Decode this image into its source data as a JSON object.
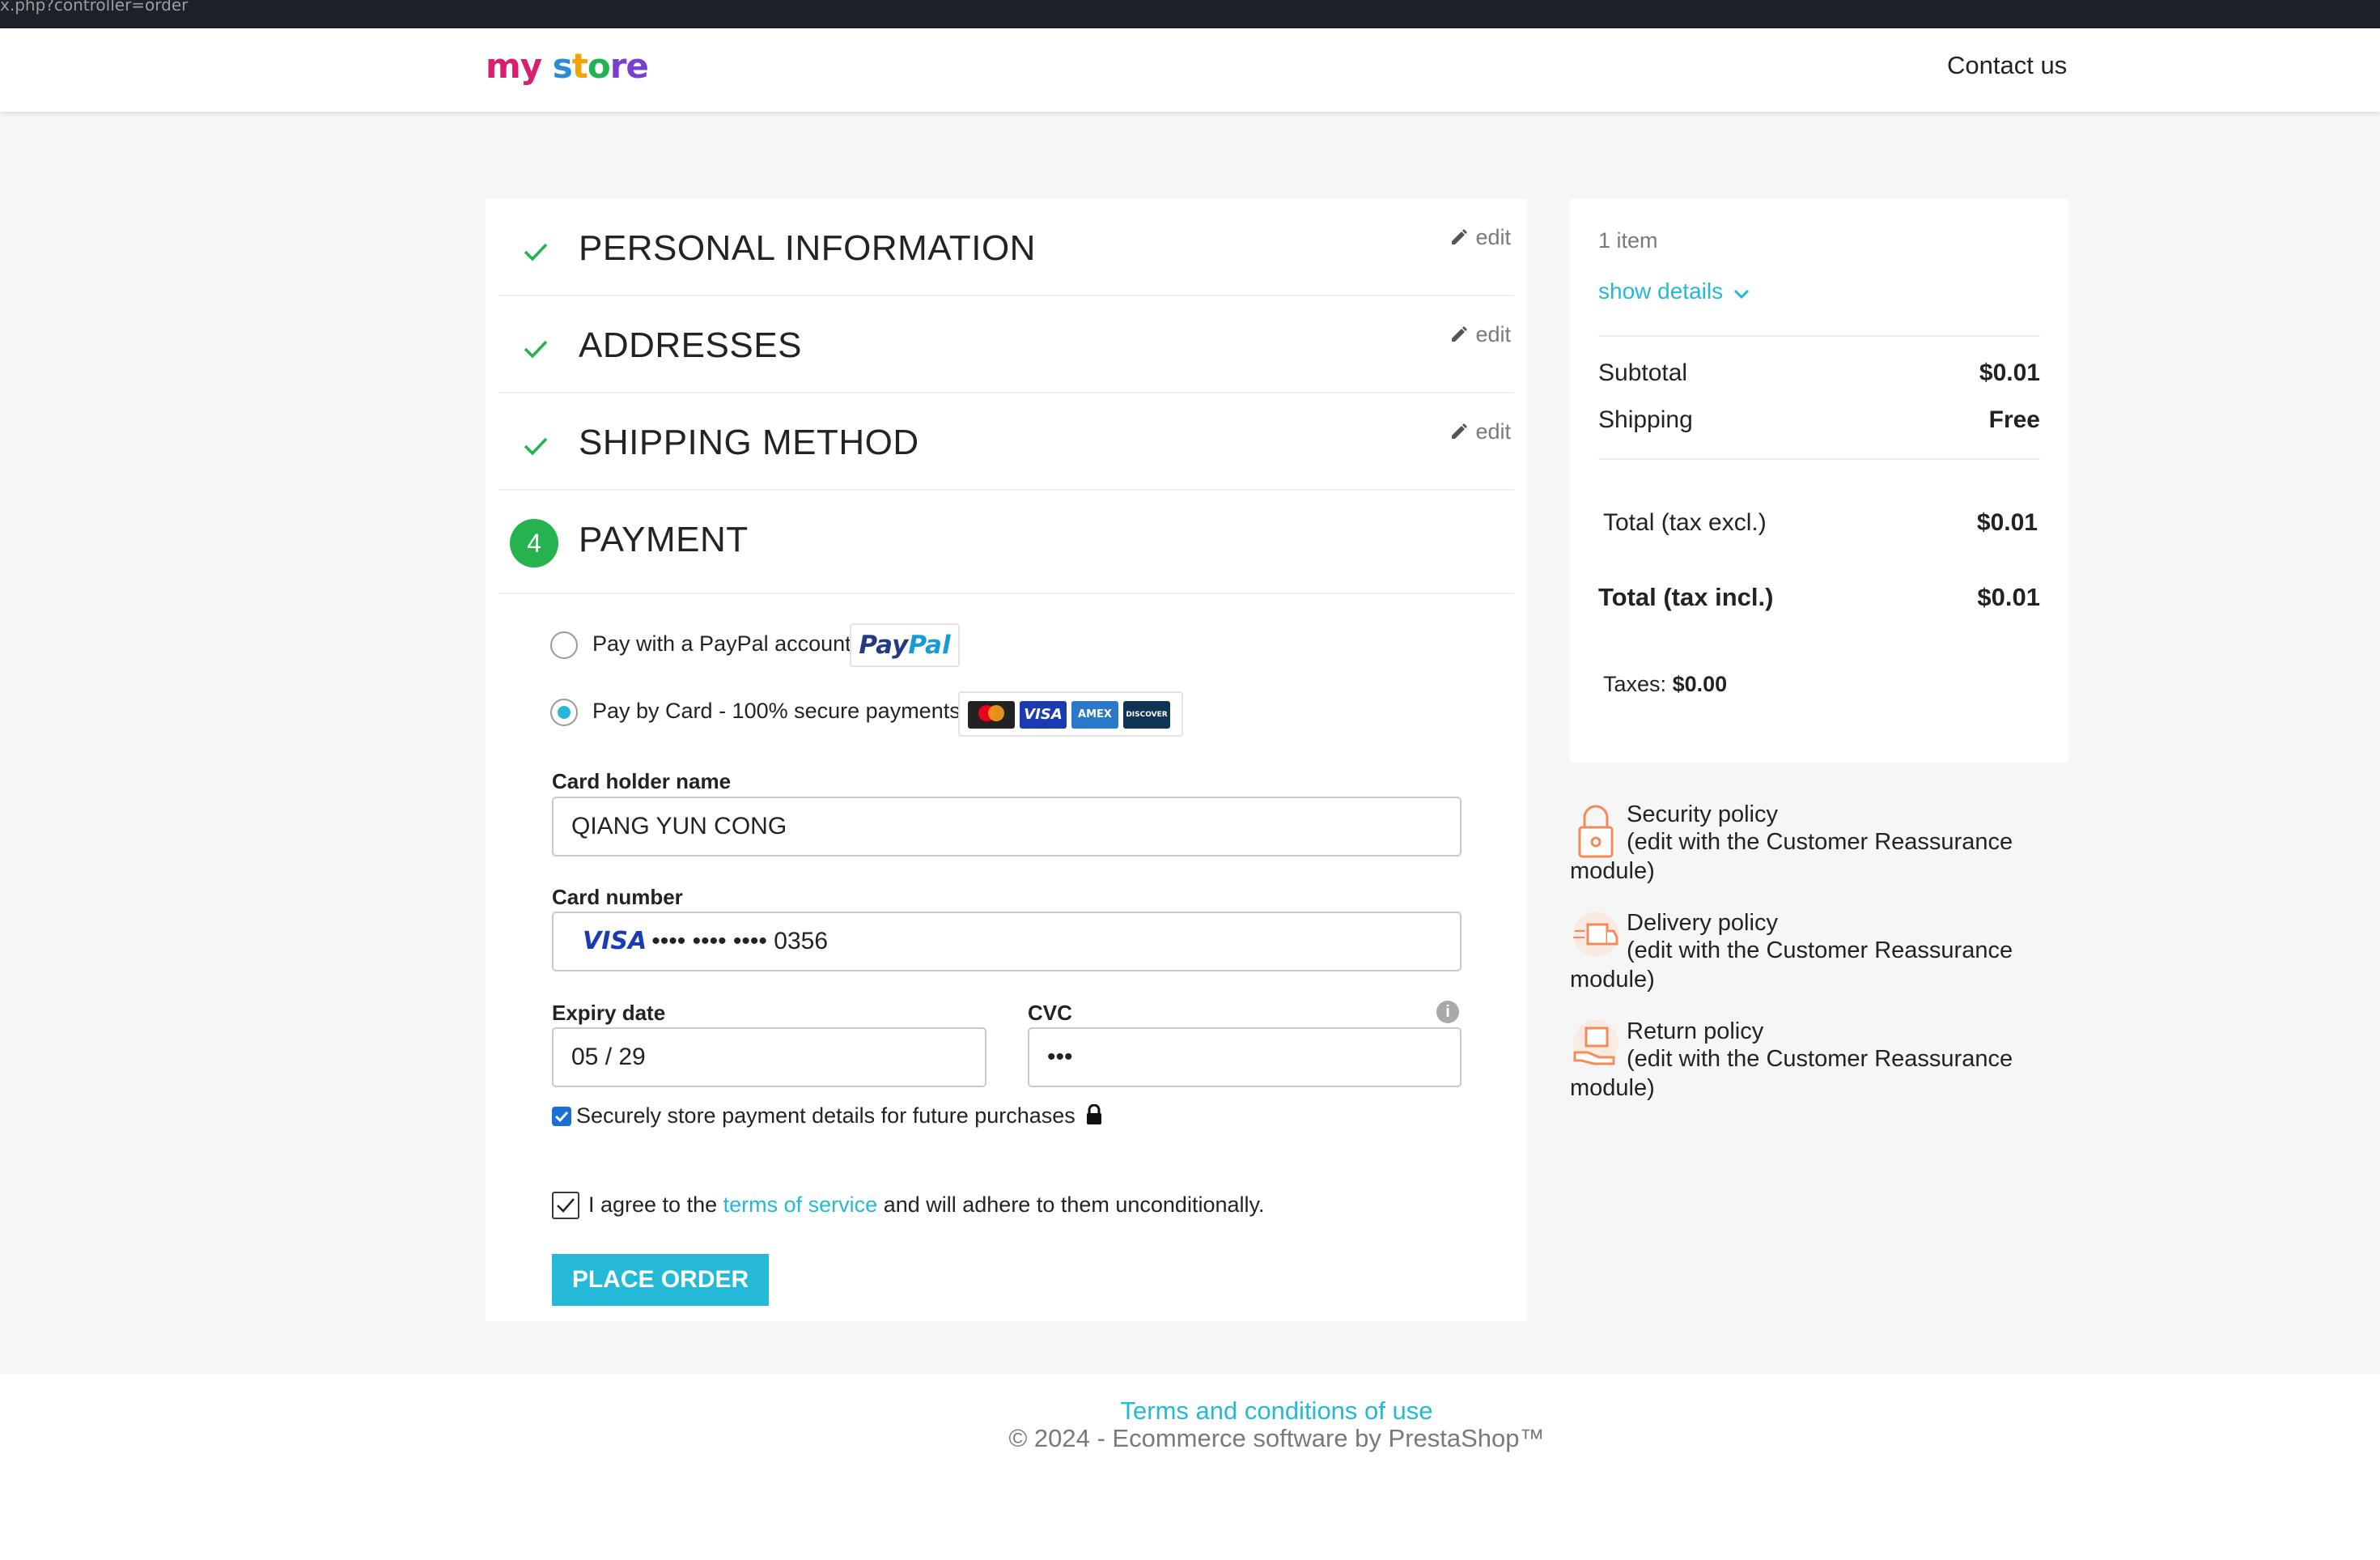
{
  "browser": {
    "url_fragment": "x.php?controller=order"
  },
  "header": {
    "logo": {
      "part1": "my",
      "part2": "s",
      "part3": "t",
      "part4": "o",
      "part5": "re"
    },
    "contact_label": "Contact us"
  },
  "steps": [
    {
      "title": "PERSONAL INFORMATION",
      "status": "complete",
      "edit_label": "edit"
    },
    {
      "title": "ADDRESSES",
      "status": "complete",
      "edit_label": "edit"
    },
    {
      "title": "SHIPPING METHOD",
      "status": "complete",
      "edit_label": "edit"
    },
    {
      "number": "4",
      "title": "PAYMENT",
      "status": "current"
    }
  ],
  "payment": {
    "options": [
      {
        "label": "Pay with a PayPal account",
        "selected": false,
        "badge": {
          "part1": "Pay",
          "part2": "Pal"
        }
      },
      {
        "label": "Pay by Card - 100% secure payments",
        "selected": true,
        "card_brands": [
          "mastercard",
          "VISA",
          "AMEX",
          "DISCOVER"
        ]
      }
    ],
    "card_holder": {
      "label": "Card holder name",
      "value": "QIANG YUN CONG"
    },
    "card_number": {
      "label": "Card number",
      "brand": "VISA",
      "value": "•••• •••• •••• 0356"
    },
    "expiry": {
      "label": "Expiry date",
      "value": "05 / 29"
    },
    "cvc": {
      "label": "CVC",
      "value": "•••",
      "info_icon": "i"
    },
    "store_details": {
      "label": "Securely store payment details for future purchases",
      "checked": true
    },
    "terms": {
      "prefix": "I agree to the",
      "link": "terms of service",
      "suffix": "and will adhere to them unconditionally.",
      "checked": true
    },
    "place_order_label": "PLACE ORDER"
  },
  "summary": {
    "items_count": "1 item",
    "show_details": "show details",
    "subtotal": {
      "label": "Subtotal",
      "value": "$0.01"
    },
    "shipping": {
      "label": "Shipping",
      "value": "Free"
    },
    "total_excl": {
      "label": "Total (tax excl.)",
      "value": "$0.01"
    },
    "total_incl": {
      "label": "Total (tax incl.)",
      "value": "$0.01"
    },
    "taxes": {
      "label": "Taxes:",
      "value": "$0.00"
    }
  },
  "reassurance": [
    {
      "title": "Security policy",
      "line1": "(edit with the Customer Reassurance",
      "line2": "module)",
      "icon": "lock-icon"
    },
    {
      "title": "Delivery policy",
      "line1": "(edit with the Customer Reassurance",
      "line2": "module)",
      "icon": "delivery-truck-icon"
    },
    {
      "title": "Return policy",
      "line1": "(edit with the Customer Reassurance",
      "line2": "module)",
      "icon": "return-box-icon"
    }
  ],
  "footer": {
    "terms_link": "Terms and conditions of use",
    "copyright": "© 2024 - Ecommerce software by PrestaShop™"
  },
  "colors": {
    "accent": "#24b9d7",
    "success": "#24b34e",
    "text": "#232323",
    "background": "#f6f6f6"
  }
}
